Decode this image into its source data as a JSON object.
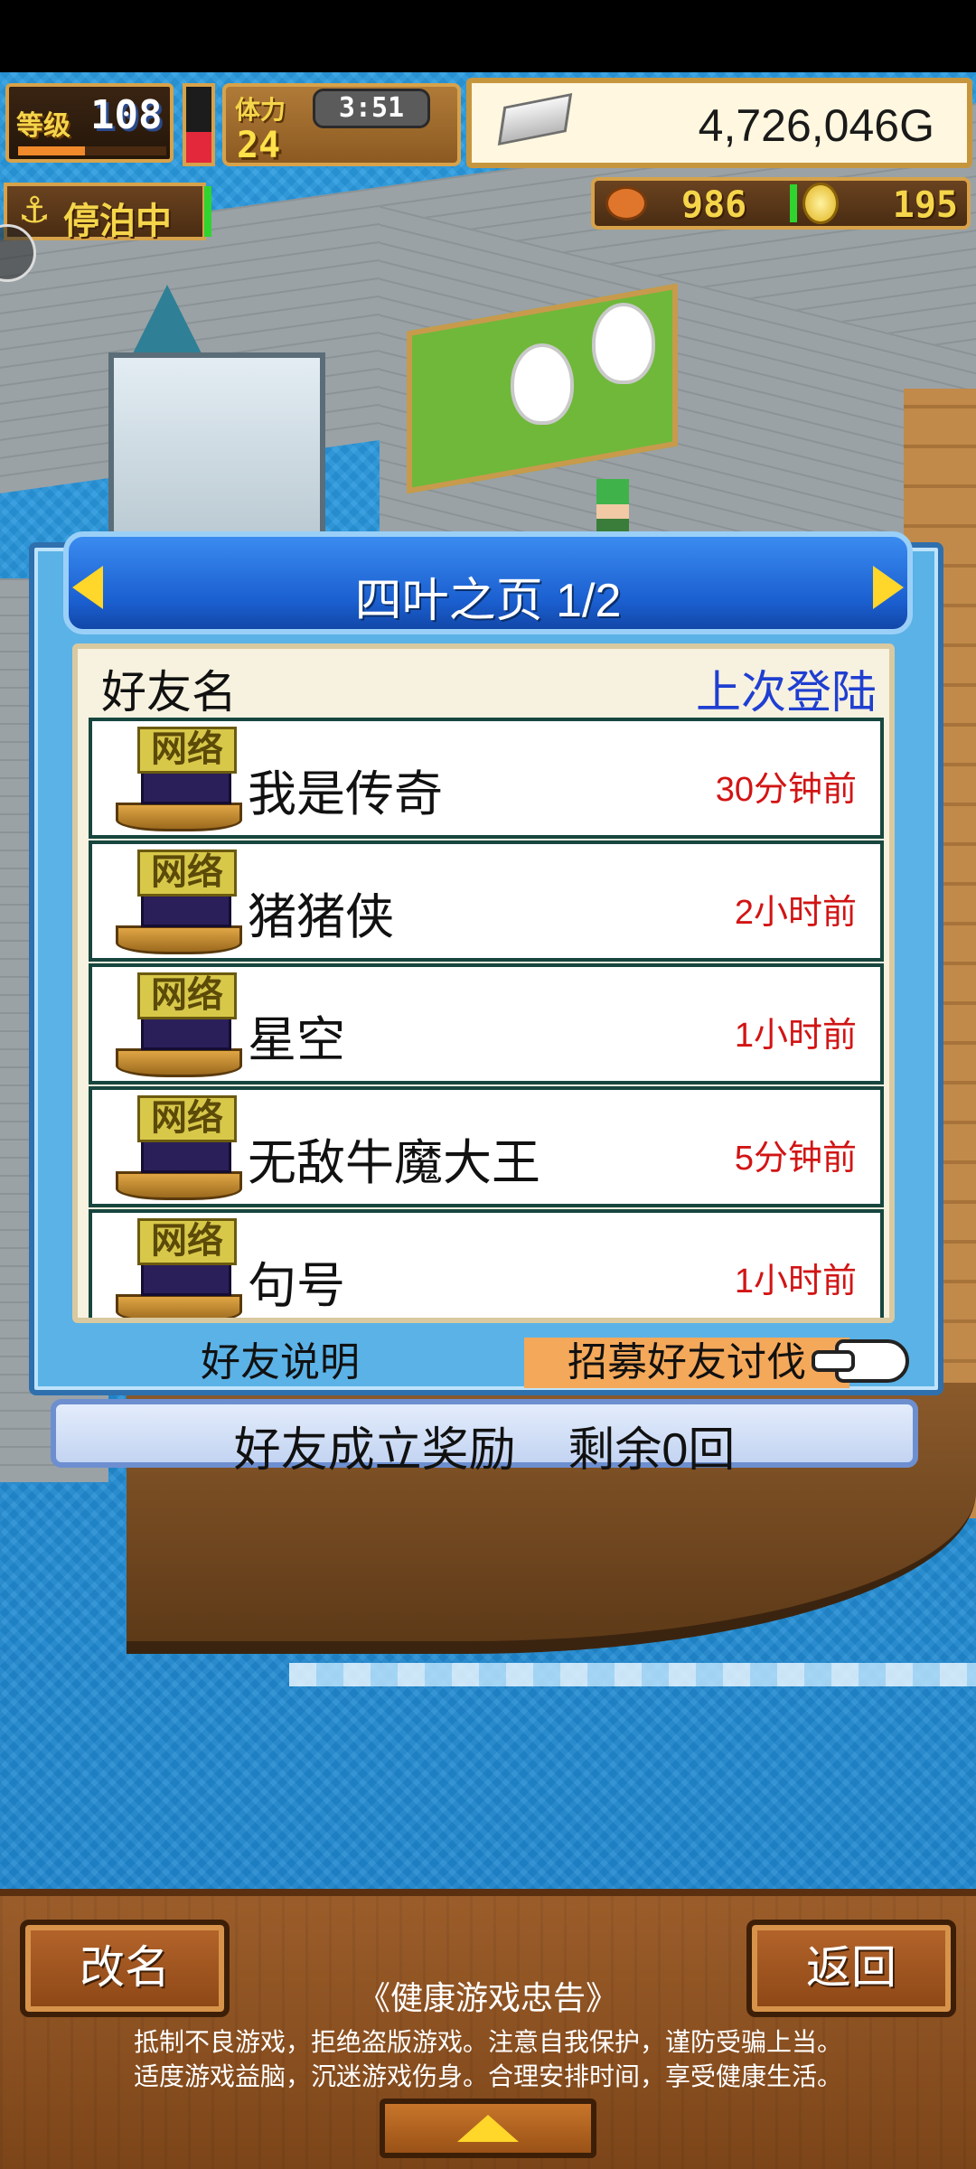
{
  "hud": {
    "level_label": "等级",
    "level_value": "108",
    "xp_fraction": 0.45,
    "stamina_label": "体力",
    "stamina_value": "24",
    "stamina_gauge_fraction": 0.4,
    "timer": "3:51",
    "gold": "4,726,046G",
    "dock_status": "停泊中",
    "anchor_icon": "⚓",
    "meat": "986",
    "coins": "195"
  },
  "dialog": {
    "title": "四叶之页 1/2",
    "col_name": "好友名",
    "col_last_login": "上次登陆",
    "ship_tag": "网络",
    "friends": [
      {
        "name": "我是传奇",
        "last_login": "30分钟前"
      },
      {
        "name": "猪猪侠",
        "last_login": "2小时前"
      },
      {
        "name": "星空",
        "last_login": "1小时前"
      },
      {
        "name": "无敌牛魔大王",
        "last_login": "5分钟前"
      },
      {
        "name": "句号",
        "last_login": "1小时前"
      }
    ],
    "explain_button": "好友说明",
    "recruit_button": "招募好友讨伐",
    "reward_text": "好友成立奖励    剩余0回"
  },
  "bottom": {
    "rename_button": "改名",
    "back_button": "返回",
    "health_title": "《健康游戏忠告》",
    "health_line1": "抵制不良游戏，拒绝盗版游戏。注意自我保护，谨防受骗上当。",
    "health_line2": "适度游戏益脑，沉迷游戏伤身。合理安排时间，享受健康生活。"
  },
  "colors": {
    "header_blue": "#1b5fd0",
    "time_red": "#d21414",
    "last_login_blue": "#1f3fd1",
    "recruit_orange": "#f4a85a",
    "arrow_yellow": "#ffd62a"
  }
}
